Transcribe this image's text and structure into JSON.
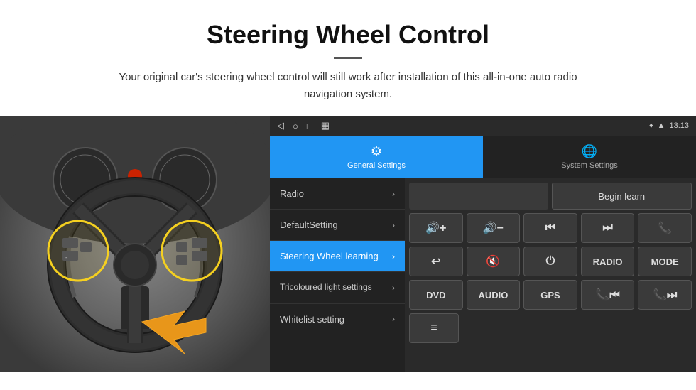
{
  "header": {
    "title": "Steering Wheel Control",
    "subtitle": "Your original car's steering wheel control will still work after installation of this all-in-one auto radio navigation system."
  },
  "status_bar": {
    "back_icon": "◁",
    "home_icon": "○",
    "recents_icon": "□",
    "screenshot_icon": "▦",
    "location_icon": "♦",
    "signal_icon": "▲",
    "time": "13:13"
  },
  "tabs": [
    {
      "id": "general",
      "label": "General Settings",
      "active": true
    },
    {
      "id": "system",
      "label": "System Settings",
      "active": false
    }
  ],
  "menu_items": [
    {
      "id": "radio",
      "label": "Radio",
      "active": false
    },
    {
      "id": "default-setting",
      "label": "DefaultSetting",
      "active": false
    },
    {
      "id": "steering-wheel",
      "label": "Steering Wheel learning",
      "active": true
    },
    {
      "id": "tricoloured",
      "label": "Tricoloured light settings",
      "active": false
    },
    {
      "id": "whitelist",
      "label": "Whitelist setting",
      "active": false
    }
  ],
  "controls": {
    "begin_learn": "Begin learn",
    "row1": [
      "🔊+",
      "🔊-",
      "⏮",
      "⏭",
      "📞"
    ],
    "row2": [
      "↩",
      "🔊×",
      "⏻",
      "RADIO",
      "MODE"
    ],
    "row3": [
      "DVD",
      "AUDIO",
      "GPS",
      "📞⏮",
      "📞⏭"
    ],
    "row4_icon": "≡"
  }
}
